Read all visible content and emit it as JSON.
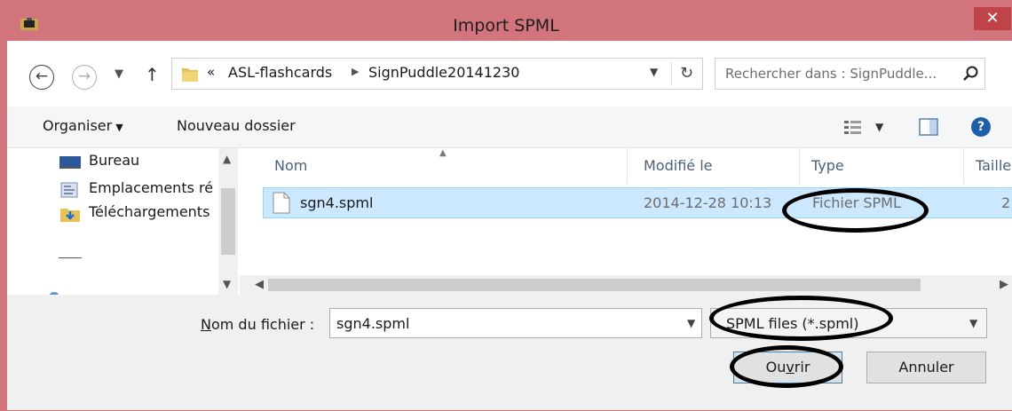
{
  "window": {
    "title": "Import SPML",
    "app_icon": "app-window-icon",
    "close_label": "✕",
    "frame_color": "#d1747c",
    "close_color": "#c1434a"
  },
  "nav": {
    "back_icon": "back-arrow-icon",
    "forward_icon": "forward-arrow-icon",
    "recent_icon": "recent-locations-dropdown-icon",
    "up_icon": "up-arrow-icon",
    "address": {
      "overflow": "«",
      "crumbs": [
        "ASL-flashcards",
        "SignPuddle20141230"
      ]
    },
    "refresh_icon": "refresh-icon",
    "search_placeholder": "Rechercher dans : SignPuddle..."
  },
  "toolbar": {
    "organize_label": "Organiser",
    "new_folder_label": "Nouveau dossier",
    "view_icon": "change-view-icon",
    "preview_pane_icon": "preview-pane-icon",
    "help_icon": "help-icon"
  },
  "sidebar": {
    "items": [
      {
        "label": "Bureau",
        "icon": "desktop-icon"
      },
      {
        "label": "Emplacements ré",
        "icon": "recent-places-icon"
      },
      {
        "label": "Téléchargements",
        "icon": "downloads-folder-icon"
      }
    ]
  },
  "filelist": {
    "columns": [
      "Nom",
      "Modifié le",
      "Type",
      "Taille"
    ],
    "rows": [
      {
        "name": "sgn4.spml",
        "modified": "2014-12-28 10:13",
        "type": "Fichier SPML",
        "size": "2",
        "icon": "file-icon"
      }
    ],
    "selection_color": "#cce8ff"
  },
  "footer": {
    "filename_label_accel": "N",
    "filename_label_rest": "om du fichier :",
    "filename_value": "sgn4.spml",
    "filetype_value": "SPML files (*.spml)",
    "open_pre": "Ou",
    "open_accel": "v",
    "open_post": "rir",
    "cancel_label": "Annuler"
  },
  "annotations": {
    "color": "#000000",
    "circled": [
      "Fichier SPML",
      "SPML files (*.spml)",
      "Ouvrir"
    ]
  }
}
